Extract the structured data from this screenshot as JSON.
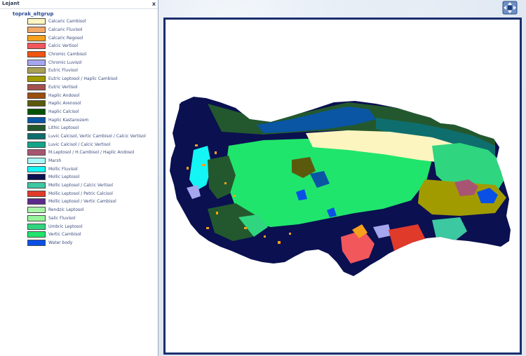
{
  "legend": {
    "title": "Lejant",
    "close_glyph": "x",
    "layer_name": "toprak_altgrup",
    "items": [
      {
        "label": "Calcaric Cambisol",
        "color": "#fdf5c0"
      },
      {
        "label": "Calcaric Fluvisol",
        "color": "#f2a866"
      },
      {
        "label": "Calcaric Regosol",
        "color": "#f6a11c"
      },
      {
        "label": "Calcic Vertisol",
        "color": "#f2575c"
      },
      {
        "label": "Chromic Cambisol",
        "color": "#f0540e"
      },
      {
        "label": "Chromic Luvisol",
        "color": "#a6a6ef"
      },
      {
        "label": "Eutric Fluvisol",
        "color": "#a8a055"
      },
      {
        "label": "Eutric Leptosol / Haplic Cambisol",
        "color": "#a29b00"
      },
      {
        "label": "Eutric Vertisol",
        "color": "#a4514e"
      },
      {
        "label": "Haplic Andosol",
        "color": "#9a4e0f"
      },
      {
        "label": "Haplic Arenosol",
        "color": "#5b5a0c"
      },
      {
        "label": "Haplic Calcisol",
        "color": "#055205"
      },
      {
        "label": "Haplic Kastanozem",
        "color": "#0a55a4"
      },
      {
        "label": "Lithic Leptosol",
        "color": "#23582e"
      },
      {
        "label": "Luvic Calcisol, Vertic Cambisol / Calcic Vertisol",
        "color": "#0e6e6e"
      },
      {
        "label": "Luvic Calcisol / Calcic Vertisol",
        "color": "#12a58a"
      },
      {
        "label": "M.Leptosol / H.Cambisol / Haplic Andosol",
        "color": "#a85573"
      },
      {
        "label": "Marsh",
        "color": "#a8f7f7"
      },
      {
        "label": "Mollic Fluvisol",
        "color": "#14f5f5"
      },
      {
        "label": "Mollic Leptosol",
        "color": "#0a1050"
      },
      {
        "label": "Mollic Leptosol / Calcic Vertisol",
        "color": "#3cc8a0"
      },
      {
        "label": "Mollic Leptosol / Petric Calcisol",
        "color": "#e03a2a"
      },
      {
        "label": "Mollic Leptosol / Vertic Cambisol",
        "color": "#5c2a8c"
      },
      {
        "label": "Rendzic Leptosol",
        "color": "#a8f5a8"
      },
      {
        "label": "Salic Fluvisol",
        "color": "#96f59a"
      },
      {
        "label": "Umbric Leptosol",
        "color": "#2fd67f"
      },
      {
        "label": "Vertic Cambisol",
        "color": "#20e56c"
      },
      {
        "label": "Water body",
        "color": "#0a50e6"
      }
    ]
  },
  "map": {
    "frame_color": "#1a2e6e",
    "nav_icon": "pan-navigation-icon"
  }
}
